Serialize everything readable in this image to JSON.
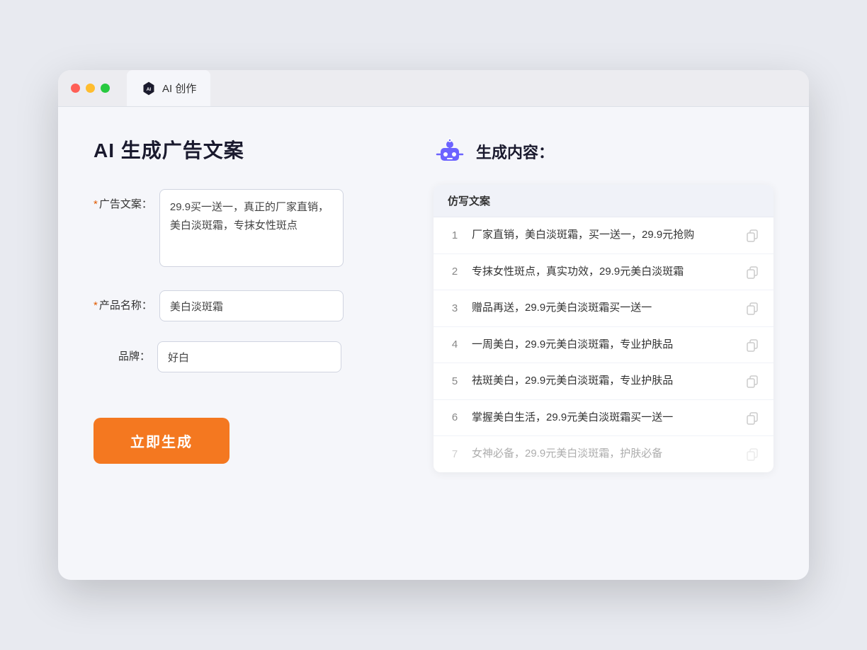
{
  "window": {
    "tab_label": "AI 创作"
  },
  "page": {
    "title": "AI 生成广告文案"
  },
  "form": {
    "ad_copy_label": "广告文案：",
    "ad_copy_required": "*",
    "ad_copy_value": "29.9买一送一，真正的厂家直销，美白淡斑霜，专抹女性斑点",
    "product_name_label": "产品名称：",
    "product_name_required": "*",
    "product_name_value": "美白淡斑霜",
    "brand_label": "品牌：",
    "brand_value": "好白",
    "generate_btn_label": "立即生成"
  },
  "result": {
    "header_label": "生成内容：",
    "table_header": "仿写文案",
    "rows": [
      {
        "num": "1",
        "text": "厂家直销，美白淡斑霜，买一送一，29.9元抢购",
        "dimmed": false
      },
      {
        "num": "2",
        "text": "专抹女性斑点，真实功效，29.9元美白淡斑霜",
        "dimmed": false
      },
      {
        "num": "3",
        "text": "赠品再送，29.9元美白淡斑霜买一送一",
        "dimmed": false
      },
      {
        "num": "4",
        "text": "一周美白，29.9元美白淡斑霜，专业护肤品",
        "dimmed": false
      },
      {
        "num": "5",
        "text": "祛斑美白，29.9元美白淡斑霜，专业护肤品",
        "dimmed": false
      },
      {
        "num": "6",
        "text": "掌握美白生活，29.9元美白淡斑霜买一送一",
        "dimmed": false
      },
      {
        "num": "7",
        "text": "女神必备，29.9元美白淡斑霜，护肤必备",
        "dimmed": true
      }
    ]
  }
}
